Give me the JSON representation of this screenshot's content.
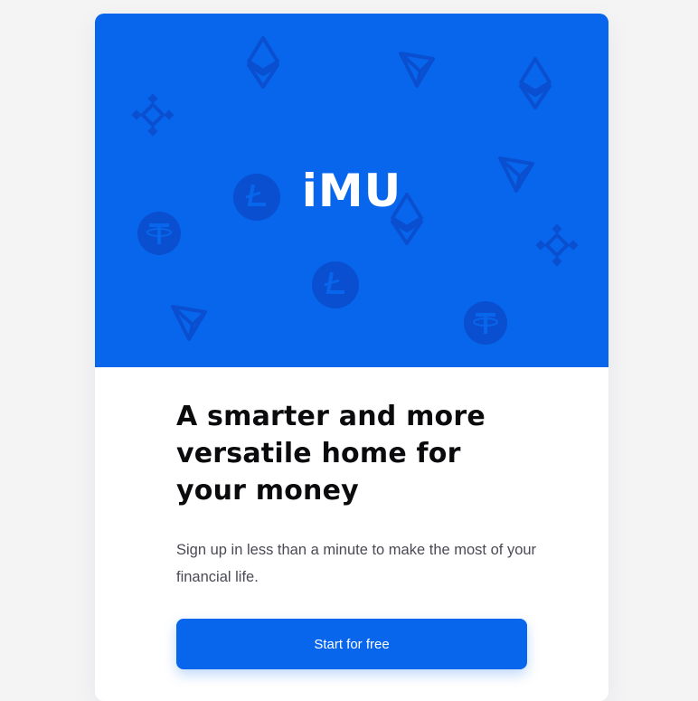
{
  "brand": {
    "logo_text": "iMU",
    "primary_color": "#0866ec"
  },
  "hero": {
    "background_icons": [
      "ethereum-icon",
      "tron-icon",
      "binance-icon",
      "litecoin-icon",
      "tether-icon"
    ]
  },
  "main": {
    "headline": "A smarter and more versatile home for your money",
    "subtext": "Sign up in less than a minute to make the most of your financial life.",
    "cta_label": "Start for free"
  }
}
